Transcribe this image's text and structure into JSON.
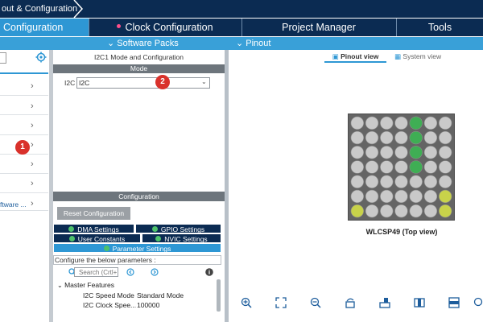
{
  "breadcrumb": {
    "text": "out & Configuration"
  },
  "tabs": {
    "pinout": "Configuration",
    "clock": "Clock Configuration",
    "project": "Project Manager",
    "tools": "Tools"
  },
  "subbar": {
    "packs": "Software Packs",
    "pinout": "Pinout"
  },
  "left": {
    "software_label": "ftware ..."
  },
  "middle": {
    "title": "I2C1 Mode and Configuration",
    "mode_header": "Mode",
    "i2c_label": "I2C",
    "i2c_value": "I2C",
    "config_header": "Configuration",
    "reset_button": "Reset Configuration",
    "settings_tabs": [
      "DMA Settings",
      "GPIO Settings",
      "User Constants",
      "NVIC Settings",
      "Parameter Settings"
    ],
    "params_caption": "Configure the below parameters :",
    "search_placeholder": "Search (Crtl+F)",
    "group": "Master Features",
    "params": [
      {
        "name": "I2C Speed Mode",
        "value": "Standard Mode"
      },
      {
        "name": "I2C Clock Spee...",
        "value": "100000"
      }
    ]
  },
  "pinout": {
    "tab_pinout": "Pinout view",
    "tab_system": "System view",
    "package": "WLCSP49 (Top view)"
  },
  "badges": [
    "1",
    "2"
  ],
  "colors": {
    "navy": "#0b2b52",
    "accent": "#2e97d4",
    "pin_green": "#3fae54",
    "pin_yellow": "#c8d24a",
    "badge": "#d9312b"
  }
}
